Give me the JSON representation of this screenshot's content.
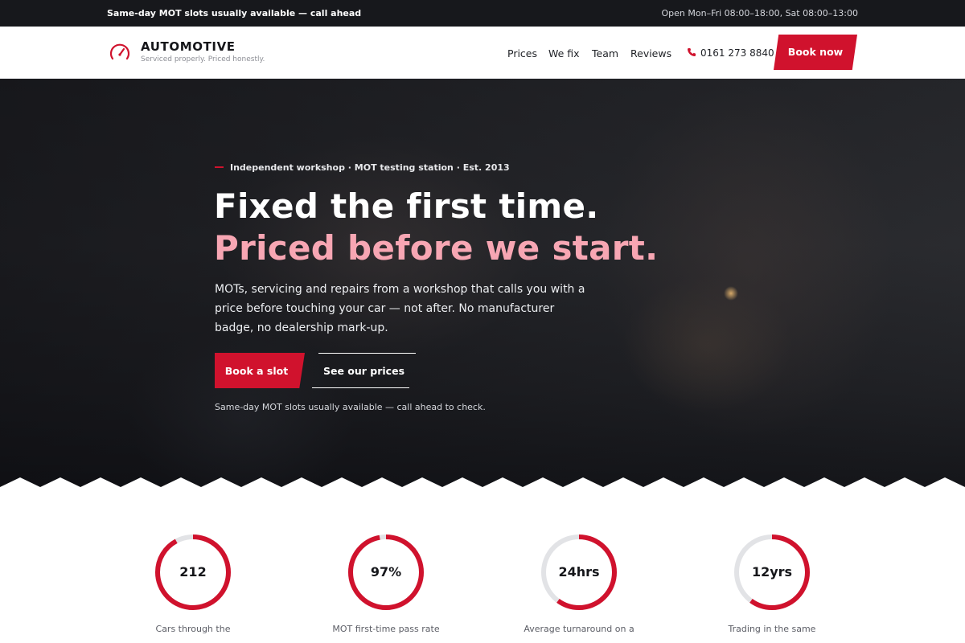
{
  "topbar": {
    "announcement": "Same-day MOT slots usually available — call ahead",
    "hours": "Open Mon–Fri 08:00–18:00, Sat 08:00–13:00"
  },
  "brand": {
    "name": "AUTOMOTIVE",
    "tagline": "Serviced properly. Priced honestly.",
    "accent_color": "#d0122d",
    "icon": "speedometer-icon"
  },
  "nav": {
    "links": [
      "Prices",
      "We fix",
      "Team",
      "Reviews"
    ],
    "phone": "0161 273 8840",
    "phone_icon": "phone-icon",
    "cta": "Book now"
  },
  "hero": {
    "eyebrow": "Independent workshop · MOT testing station · Est. 2013",
    "headline_line1": "Fixed the first time.",
    "headline_line2": "Priced before we start.",
    "headline_line2_color": "#f7a6b3",
    "lead": "MOTs, servicing and repairs from a workshop that calls you with a price before touching your car — not after. No manufacturer badge, no dealership mark-up.",
    "primary_button": "Book a slot",
    "secondary_button": "See our prices",
    "note": "Same-day MOT slots usually available — call ahead to check."
  },
  "stats": [
    {
      "value": "212",
      "label": "Cars through the",
      "progress": 0.92
    },
    {
      "value": "97%",
      "label": "MOT first-time pass rate",
      "progress": 0.97
    },
    {
      "value": "24hrs",
      "label": "Average turnaround on a",
      "progress": 0.6
    },
    {
      "value": "12yrs",
      "label": "Trading in the same",
      "progress": 0.6
    }
  ]
}
